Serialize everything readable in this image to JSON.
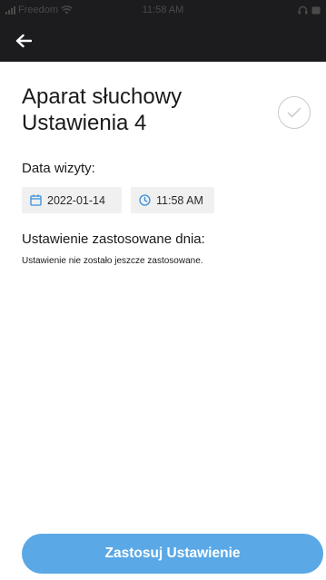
{
  "status_bar": {
    "carrier": "Freedom",
    "time": "11:58 AM"
  },
  "header": {
    "back_icon": "arrow-left-icon"
  },
  "page": {
    "title": "Aparat słuchowy Ustawienia 4",
    "status_icon": "check-circle-icon",
    "visit_label": "Data wizyty:",
    "visit_date": "2022-01-14",
    "visit_time": "11:58 AM",
    "applied_label": "Ustawienie zastosowane dnia:",
    "applied_value": "Ustawienie nie zostało jeszcze zastosowane."
  },
  "actions": {
    "apply_label": "Zastosuj Ustawienie"
  },
  "colors": {
    "header_bg": "#1c1c1e",
    "accent": "#5aa8e6",
    "chip_bg": "#f0f0f0"
  }
}
